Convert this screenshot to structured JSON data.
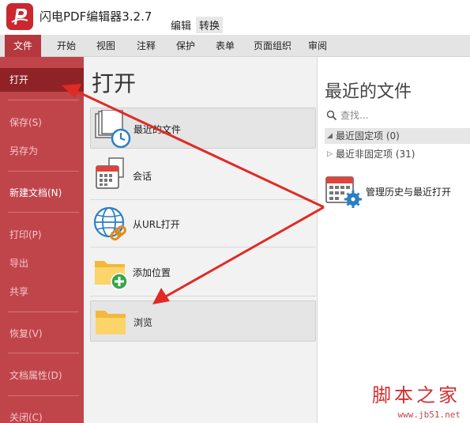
{
  "app": {
    "title": "闪电PDF编辑器3.2.7",
    "mode_tabs": [
      "编辑",
      "转换"
    ]
  },
  "ribbon": {
    "tabs": [
      "文件",
      "开始",
      "视图",
      "注释",
      "保护",
      "表单",
      "页面组织",
      "审阅"
    ],
    "active": "文件"
  },
  "sidebar": {
    "items": [
      {
        "label": "打开",
        "state": "active"
      },
      {
        "label": "保存(S)",
        "state": "disabled"
      },
      {
        "label": "另存为",
        "state": "disabled"
      },
      {
        "label": "新建文档(N)",
        "state": "enabled"
      },
      {
        "label": "打印(P)",
        "state": "disabled"
      },
      {
        "label": "导出",
        "state": "disabled"
      },
      {
        "label": "共享",
        "state": "disabled"
      },
      {
        "label": "恢复(V)",
        "state": "disabled"
      },
      {
        "label": "文档属性(D)",
        "state": "disabled"
      },
      {
        "label": "关闭(C)",
        "state": "disabled"
      }
    ]
  },
  "open_panel": {
    "title": "打开",
    "options": [
      {
        "label": "最近的文件",
        "icon": "recent-files-clock-icon"
      },
      {
        "label": "会话",
        "icon": "session-calendar-icon"
      },
      {
        "label": "从URL打开",
        "icon": "globe-link-icon"
      },
      {
        "label": "添加位置",
        "icon": "folder-add-icon"
      },
      {
        "label": "浏览",
        "icon": "folder-icon"
      }
    ]
  },
  "recent_panel": {
    "title": "最近的文件",
    "search_placeholder": "查找...",
    "groups": [
      {
        "label": "最近固定项 (0)",
        "expanded": true
      },
      {
        "label": "最近非固定项 (31)",
        "expanded": false
      }
    ],
    "history_label": "管理历史与最近打开"
  },
  "watermark": {
    "main": "脚本之家",
    "url": "www.jb51.net"
  },
  "colors": {
    "accent": "#b6373d",
    "sidebar": "#c0454b",
    "annotation_arrow": "#e02a24"
  }
}
